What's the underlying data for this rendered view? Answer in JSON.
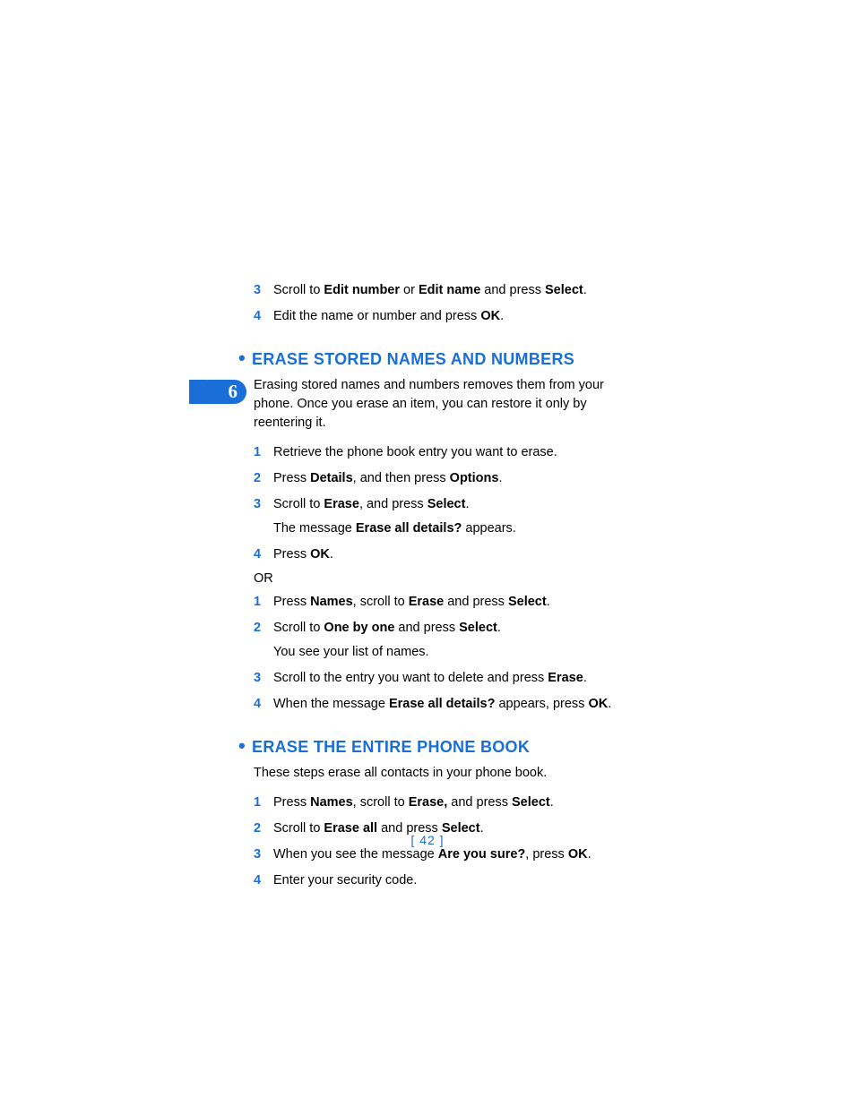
{
  "chapter": "6",
  "top_steps": [
    {
      "n": "3",
      "parts": [
        "Scroll to ",
        "Edit number",
        " or ",
        "Edit name",
        " and press ",
        "Select",
        "."
      ]
    },
    {
      "n": "4",
      "parts": [
        "Edit the name or number and press ",
        "OK",
        "."
      ]
    }
  ],
  "section1": {
    "title": "ERASE STORED NAMES AND NUMBERS",
    "intro": "Erasing stored names and numbers removes them from your phone. Once you erase an item, you can restore it only by reentering it.",
    "steps_a": [
      {
        "n": "1",
        "parts": [
          "Retrieve the phone book entry you want to erase."
        ]
      },
      {
        "n": "2",
        "parts": [
          "Press ",
          "Details",
          ", and then press ",
          "Options",
          "."
        ]
      },
      {
        "n": "3",
        "parts": [
          "Scroll to ",
          "Erase",
          ", and press ",
          "Select",
          "."
        ],
        "sub_parts": [
          "The message ",
          "Erase all details?",
          " appears."
        ]
      },
      {
        "n": "4",
        "parts": [
          "Press ",
          "OK",
          "."
        ]
      }
    ],
    "or": "OR",
    "steps_b": [
      {
        "n": "1",
        "parts": [
          "Press ",
          "Names",
          ", scroll to ",
          "Erase",
          " and press ",
          "Select",
          "."
        ]
      },
      {
        "n": "2",
        "parts": [
          "Scroll to ",
          "One by one",
          " and press ",
          "Select",
          "."
        ],
        "sub_parts": [
          "You see your list of names."
        ]
      },
      {
        "n": "3",
        "parts": [
          "Scroll to the entry you want to delete and press ",
          "Erase",
          "."
        ]
      },
      {
        "n": "4",
        "parts": [
          "When the message ",
          "Erase all details?",
          " appears, press ",
          "OK",
          "."
        ]
      }
    ]
  },
  "section2": {
    "title": "ERASE THE ENTIRE PHONE BOOK",
    "intro": "These steps erase all contacts in your phone book.",
    "steps": [
      {
        "n": "1",
        "parts": [
          "Press ",
          "Names",
          ", scroll to ",
          "Erase,",
          " and press ",
          "Select",
          "."
        ]
      },
      {
        "n": "2",
        "parts": [
          "Scroll to ",
          "Erase all",
          " and press ",
          "Select",
          "."
        ]
      },
      {
        "n": "3",
        "parts": [
          "When you see the message ",
          "Are you sure?",
          ", press ",
          "OK",
          "."
        ]
      },
      {
        "n": "4",
        "parts": [
          "Enter your security code."
        ]
      }
    ]
  },
  "page_number": "[ 42 ]"
}
